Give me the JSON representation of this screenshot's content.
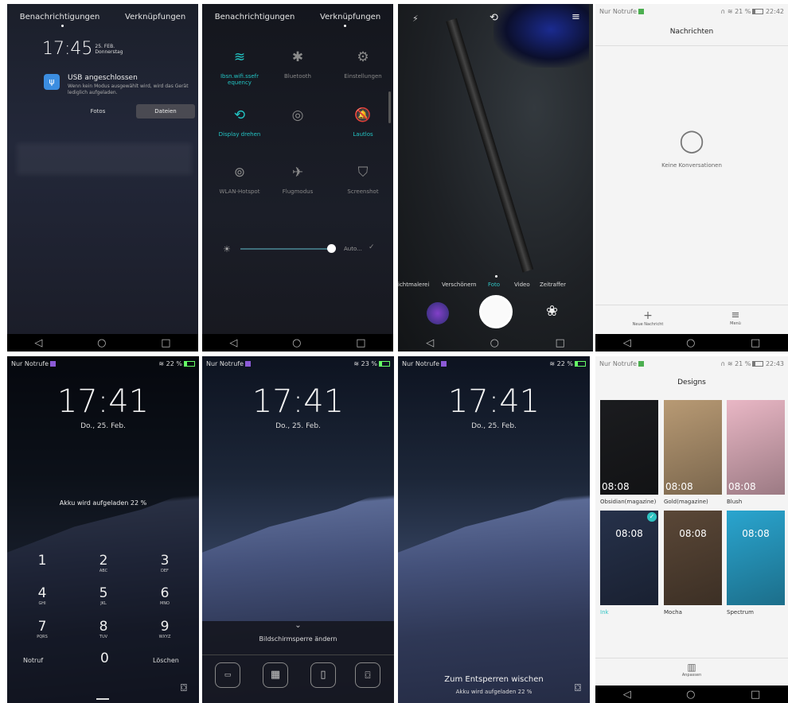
{
  "p1": {
    "tabs": [
      "Benachrichtigungen",
      "Verknüpfungen"
    ],
    "time": "17:45",
    "date_day": "25. FEB.",
    "date_weekday": "Donnerstag",
    "notif_title": "USB angeschlossen",
    "notif_text": "Wenn kein Modus ausgewählt wird, wird das Gerät lediglich aufgeladen.",
    "btn_photos": "Fotos",
    "btn_files": "Dateien"
  },
  "p2": {
    "tabs": [
      "Benachrichtigungen",
      "Verknüpfungen"
    ],
    "tiles": [
      {
        "label": "Ibsn.wifi.ssefr equency",
        "icon": "≋",
        "on": true
      },
      {
        "label": "Bluetooth",
        "icon": "✱",
        "on": false
      },
      {
        "label": "Einstellungen",
        "icon": "⚙",
        "on": false
      },
      {
        "label": "Display drehen",
        "icon": "⟲",
        "on": true
      },
      {
        "label": "",
        "icon": "◎",
        "on": false
      },
      {
        "label": "Lautlos",
        "icon": "🔕",
        "on": true
      },
      {
        "label": "WLAN-Hotspot",
        "icon": "⊚",
        "on": false
      },
      {
        "label": "Flugmodus",
        "icon": "✈",
        "on": false
      },
      {
        "label": "Screenshot",
        "icon": "⛉",
        "on": false
      }
    ],
    "brightness_label": "Auto..."
  },
  "p3": {
    "modes": [
      "ichtmalerei",
      "Verschönern",
      "Foto",
      "Video",
      "Zeitraffer"
    ]
  },
  "p4": {
    "carrier": "Nur Notrufe",
    "status_right": "21 %",
    "time": "22:42",
    "title": "Nachrichten",
    "empty": "Keine Konversationen",
    "new_message": "Neue Nachricht",
    "menu": "Menü"
  },
  "p5": {
    "carrier": "Nur Notrufe",
    "battery": "22 %",
    "clock": "17:41",
    "date": "Do., 25. Feb.",
    "charging": "Akku wird aufgeladen 22 %",
    "keys": [
      {
        "n": "1",
        "l": ""
      },
      {
        "n": "2",
        "l": "ABC"
      },
      {
        "n": "3",
        "l": "DEF"
      },
      {
        "n": "4",
        "l": "GHI"
      },
      {
        "n": "5",
        "l": "JKL"
      },
      {
        "n": "6",
        "l": "MNO"
      },
      {
        "n": "7",
        "l": "PQRS"
      },
      {
        "n": "8",
        "l": "TUV"
      },
      {
        "n": "9",
        "l": "WXYZ"
      }
    ],
    "emergency": "Notruf",
    "zero": "0",
    "delete": "Löschen"
  },
  "p6": {
    "carrier": "Nur Notrufe",
    "battery": "23 %",
    "clock": "17:41",
    "date": "Do., 25. Feb.",
    "change": "Bildschirmsperre ändern"
  },
  "p7": {
    "carrier": "Nur Notrufe",
    "battery": "22 %",
    "clock": "17:41",
    "date": "Do., 25. Feb.",
    "swipe": "Zum Entsperren wischen",
    "charging": "Akku wird aufgeladen 22 %"
  },
  "p8": {
    "carrier": "Nur Notrufe",
    "status_right": "21 %",
    "time": "22:43",
    "title": "Designs",
    "themes": [
      {
        "name": "Obsidian(magazine)",
        "time": "08:08",
        "bg": "#1b1c1f"
      },
      {
        "name": "Gold(magazine)",
        "time": "08:08",
        "bg": "#b89a74"
      },
      {
        "name": "Blush",
        "time": "08:08",
        "bg": "#e9b7c5"
      },
      {
        "name": "Ink",
        "time": "08:08",
        "bg": "#26314a"
      },
      {
        "name": "Mocha",
        "time": "08:08",
        "bg": "#5a4737"
      },
      {
        "name": "Spectrum",
        "time": "08:08",
        "bg": "#2aa5cf"
      }
    ],
    "customize": "Anpassen"
  }
}
